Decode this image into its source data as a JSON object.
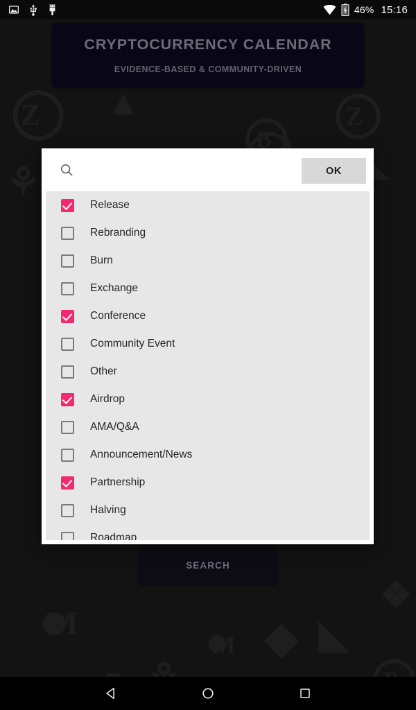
{
  "status_bar": {
    "left_icons": [
      "image-icon",
      "usb-icon",
      "android-debug-icon"
    ],
    "wifi_icon": "wifi-icon",
    "battery_icon": "battery-charging-icon",
    "battery_level": "46%",
    "clock": "15:16"
  },
  "app": {
    "title": "CRYPTOCURRENCY CALENDAR",
    "subtitle": "EVIDENCE-BASED & COMMUNITY-DRIVEN",
    "search_button_label": "SEARCH",
    "header_bg": "#0d0a22",
    "background": "#1c1c1c"
  },
  "dialog": {
    "search": {
      "icon": "search-icon",
      "value": "",
      "placeholder": ""
    },
    "ok_label": "OK",
    "accent_color": "#f4286e",
    "list_bg": "#e7e7e7",
    "options": [
      {
        "label": "Release",
        "checked": true
      },
      {
        "label": "Rebranding",
        "checked": false
      },
      {
        "label": "Burn",
        "checked": false
      },
      {
        "label": "Exchange",
        "checked": false
      },
      {
        "label": "Conference",
        "checked": true
      },
      {
        "label": "Community Event",
        "checked": false
      },
      {
        "label": "Other",
        "checked": false
      },
      {
        "label": "Airdrop",
        "checked": true
      },
      {
        "label": "AMA/Q&A",
        "checked": false
      },
      {
        "label": "Announcement/News",
        "checked": false
      },
      {
        "label": "Partnership",
        "checked": true
      },
      {
        "label": "Halving",
        "checked": false
      },
      {
        "label": "Roadmap",
        "checked": false
      }
    ]
  },
  "nav_bar": {
    "back": "back-icon",
    "home": "home-icon",
    "recents": "recents-icon"
  }
}
